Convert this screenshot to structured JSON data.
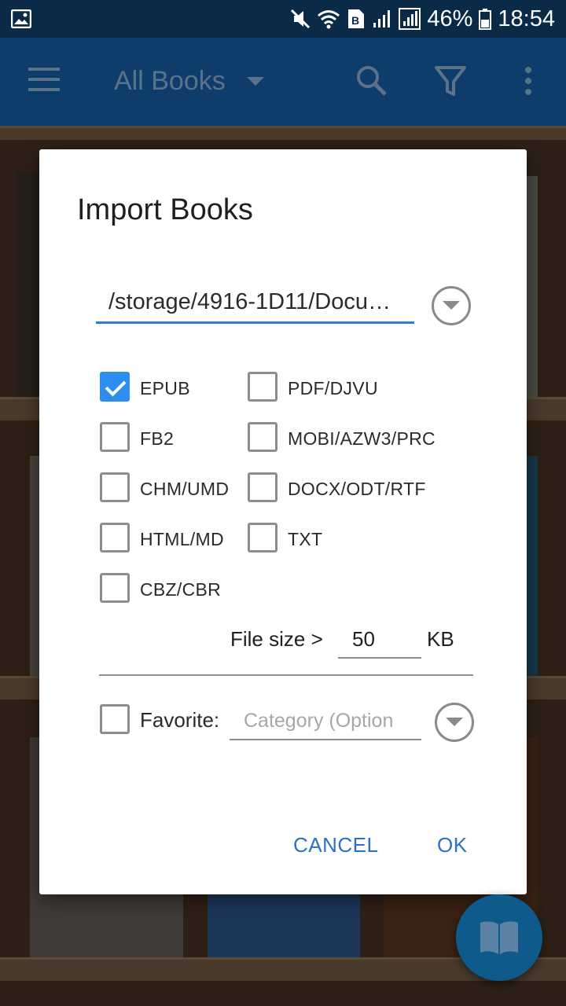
{
  "status_bar": {
    "battery": "46%",
    "time": "18:54"
  },
  "app_bar": {
    "title": "All Books"
  },
  "dialog": {
    "title": "Import Books",
    "path": "/storage/4916-1D11/Docu…",
    "formats": [
      {
        "label": "EPUB",
        "checked": true
      },
      {
        "label": "PDF/DJVU",
        "checked": false
      },
      {
        "label": "FB2",
        "checked": false
      },
      {
        "label": "MOBI/AZW3/PRC",
        "checked": false
      },
      {
        "label": "CHM/UMD",
        "checked": false
      },
      {
        "label": "DOCX/ODT/RTF",
        "checked": false
      },
      {
        "label": "HTML/MD",
        "checked": false
      },
      {
        "label": "TXT",
        "checked": false
      },
      {
        "label": "CBZ/CBR",
        "checked": false
      }
    ],
    "file_size_label": "File size >",
    "file_size_value": "50",
    "file_size_unit": "KB",
    "favorite_label": "Favorite:",
    "favorite_checked": false,
    "category_placeholder": "Category (Option",
    "cancel_label": "CANCEL",
    "ok_label": "OK"
  },
  "colors": {
    "accent": "#2e8ef0",
    "app_bar": "#0e3d6b",
    "status_bar": "#0a2a48",
    "button_text": "#2f6fc4"
  },
  "icons": [
    "image-icon",
    "mute-icon",
    "wifi-icon",
    "data-saver-icon",
    "signal-icon",
    "battery-icon",
    "menu-icon",
    "search-icon",
    "filter-icon",
    "more-icon",
    "dropdown-icon",
    "book-icon"
  ]
}
